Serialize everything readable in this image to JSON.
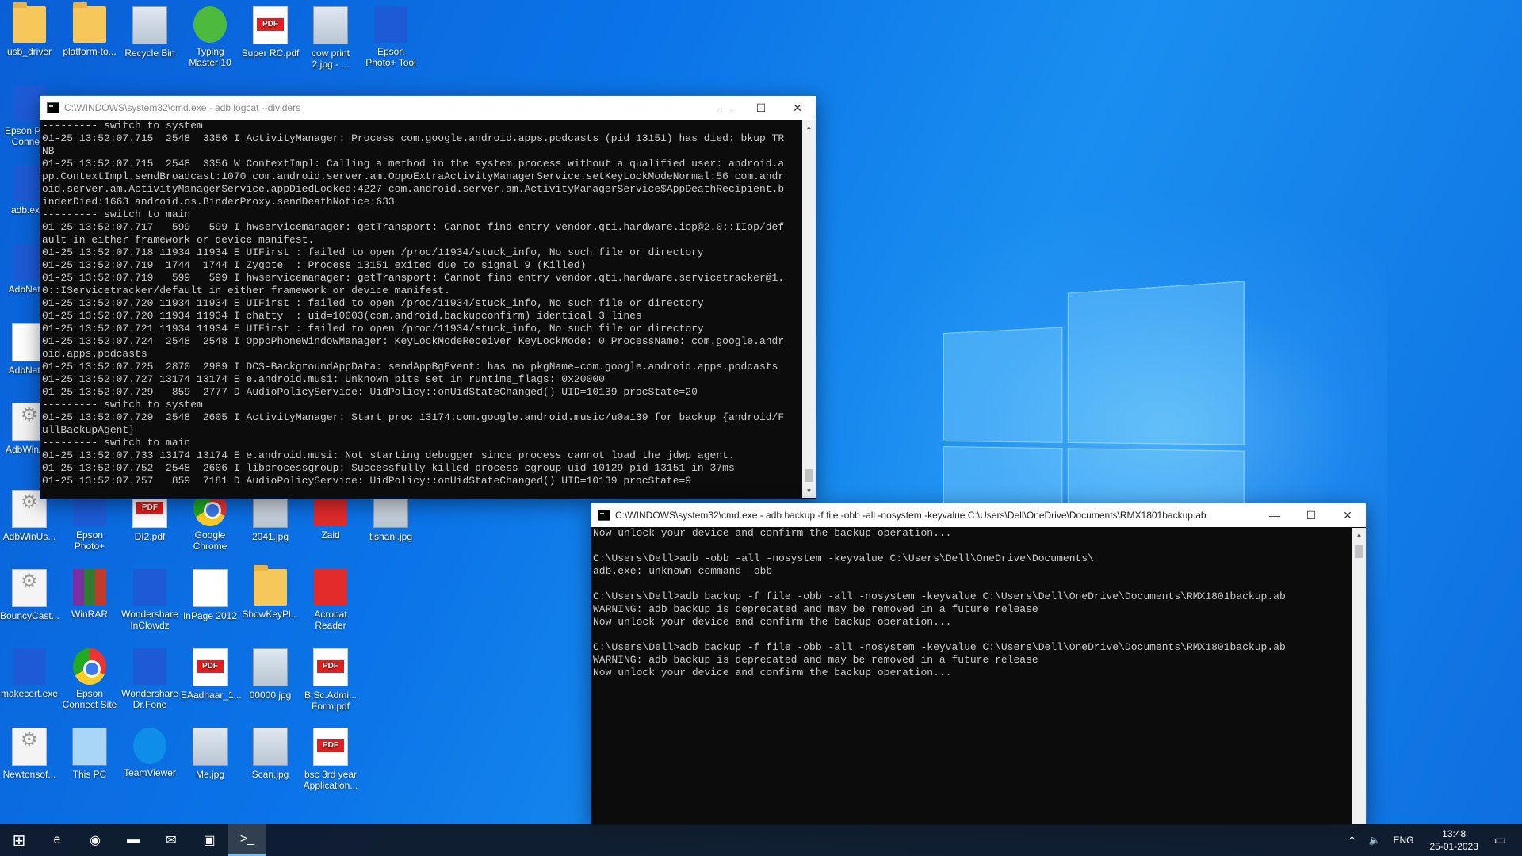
{
  "desktop": {
    "icons": [
      {
        "label": "usb_driver",
        "type": "folder"
      },
      {
        "label": "platform-to...",
        "type": "folder"
      },
      {
        "label": "Recycle Bin",
        "type": "recycle"
      },
      {
        "label": "Typing Master 10",
        "type": "green"
      },
      {
        "label": "Super RC.pdf",
        "type": "pdf"
      },
      {
        "label": "cow print 2.jpg - ...",
        "type": "photo"
      },
      {
        "label": "Epson Photo+ Tool",
        "type": "blue"
      },
      {
        "label": "Epson Pri... Connect",
        "type": "blue"
      },
      {
        "label": "adb.ex...",
        "type": "blue"
      },
      {
        "label": "AdbNati...",
        "type": "blue"
      },
      {
        "label": "AdbNati...",
        "type": "file"
      },
      {
        "label": "AdbWinA...",
        "type": "gear"
      },
      {
        "label": "AdbWinUs...",
        "type": "gear"
      },
      {
        "label": "Epson Photo+",
        "type": "blue"
      },
      {
        "label": "DI2.pdf",
        "type": "pdf"
      },
      {
        "label": "Google Chrome",
        "type": "chrome"
      },
      {
        "label": "2041.jpg",
        "type": "photo"
      },
      {
        "label": "Zaid",
        "type": "red"
      },
      {
        "label": "tishani.jpg",
        "type": "photo"
      },
      {
        "label": "BouncyCast...",
        "type": "gear"
      },
      {
        "label": "WinRAR",
        "type": "rar"
      },
      {
        "label": "Wondershare InClowdz",
        "type": "blue"
      },
      {
        "label": "InPage 2012",
        "type": "file"
      },
      {
        "label": "ShowKeyPl...",
        "type": "folder"
      },
      {
        "label": "Acrobat Reader",
        "type": "red"
      },
      {
        "label": "makecert.exe",
        "type": "blue"
      },
      {
        "label": "Epson Connect Site",
        "type": "chrome"
      },
      {
        "label": "Wondershare Dr.Fone",
        "type": "blue"
      },
      {
        "label": "EAadhaar_1...",
        "type": "pdf"
      },
      {
        "label": "00000.jpg",
        "type": "photo"
      },
      {
        "label": "B.Sc.Admi... Form.pdf",
        "type": "pdf"
      },
      {
        "label": "Newtonsof...",
        "type": "gear"
      },
      {
        "label": "This PC",
        "type": "pc"
      },
      {
        "label": "TeamViewer",
        "type": "tv"
      },
      {
        "label": "Me.jpg",
        "type": "photo"
      },
      {
        "label": "Scan.jpg",
        "type": "photo"
      },
      {
        "label": "bsc 3rd year Application...",
        "type": "pdf"
      }
    ]
  },
  "window1": {
    "title": "C:\\WINDOWS\\system32\\cmd.exe - adb  logcat --dividers",
    "lines": [
      "--------- switch to system",
      "01-25 13:52:07.715  2548  3356 I ActivityManager: Process com.google.android.apps.podcasts (pid 13151) has died: bkup TR",
      "NB",
      "01-25 13:52:07.715  2548  3356 W ContextImpl: Calling a method in the system process without a qualified user: android.a",
      "pp.ContextImpl.sendBroadcast:1070 com.android.server.am.OppoExtraActivityManagerService.setKeyLockModeNormal:56 com.andr",
      "oid.server.am.ActivityManagerService.appDiedLocked:4227 com.android.server.am.ActivityManagerService$AppDeathRecipient.b",
      "inderDied:1663 android.os.BinderProxy.sendDeathNotice:633",
      "--------- switch to main",
      "01-25 13:52:07.717   599   599 I hwservicemanager: getTransport: Cannot find entry vendor.qti.hardware.iop@2.0::IIop/def",
      "ault in either framework or device manifest.",
      "01-25 13:52:07.718 11934 11934 E UIFirst : failed to open /proc/11934/stuck_info, No such file or directory",
      "01-25 13:52:07.719  1744  1744 I Zygote  : Process 13151 exited due to signal 9 (Killed)",
      "01-25 13:52:07.719   599   599 I hwservicemanager: getTransport: Cannot find entry vendor.qti.hardware.servicetracker@1.",
      "0::IServicetracker/default in either framework or device manifest.",
      "01-25 13:52:07.720 11934 11934 E UIFirst : failed to open /proc/11934/stuck_info, No such file or directory",
      "01-25 13:52:07.720 11934 11934 I chatty  : uid=10003(com.android.backupconfirm) identical 3 lines",
      "01-25 13:52:07.721 11934 11934 E UIFirst : failed to open /proc/11934/stuck_info, No such file or directory",
      "01-25 13:52:07.724  2548  2548 I OppoPhoneWindowManager: KeyLockModeReceiver KeyLockMode: 0 ProcessName: com.google.andr",
      "oid.apps.podcasts",
      "01-25 13:52:07.725  2870  2989 I DCS-BackgroundAppData: sendAppBgEvent: has no pkgName=com.google.android.apps.podcasts",
      "01-25 13:52:07.727 13174 13174 E e.android.musi: Unknown bits set in runtime_flags: 0x20000",
      "01-25 13:52:07.729   859  2777 D AudioPolicyService: UidPolicy::onUidStateChanged() UID=10139 procState=20",
      "--------- switch to system",
      "01-25 13:52:07.729  2548  2605 I ActivityManager: Start proc 13174:com.google.android.music/u0a139 for backup {android/F",
      "ullBackupAgent}",
      "--------- switch to main",
      "01-25 13:52:07.733 13174 13174 E e.android.musi: Not starting debugger since process cannot load the jdwp agent.",
      "01-25 13:52:07.752  2548  2606 I libprocessgroup: Successfully killed process cgroup uid 10129 pid 13151 in 37ms",
      "01-25 13:52:07.757   859  7181 D AudioPolicyService: UidPolicy::onUidStateChanged() UID=10139 procState=9"
    ]
  },
  "window2": {
    "title": "C:\\WINDOWS\\system32\\cmd.exe - adb  backup -f file -obb -all -nosystem -keyvalue C:\\Users\\Dell\\OneDrive\\Documents\\RMX1801backup.ab",
    "lines": [
      "Now unlock your device and confirm the backup operation...",
      "",
      "C:\\Users\\Dell>adb -obb -all -nosystem -keyvalue C:\\Users\\Dell\\OneDrive\\Documents\\",
      "adb.exe: unknown command -obb",
      "",
      "C:\\Users\\Dell>adb backup -f file -obb -all -nosystem -keyvalue C:\\Users\\Dell\\OneDrive\\Documents\\RMX1801backup.ab",
      "WARNING: adb backup is deprecated and may be removed in a future release",
      "Now unlock your device and confirm the backup operation...",
      "",
      "C:\\Users\\Dell>adb backup -f file -obb -all -nosystem -keyvalue C:\\Users\\Dell\\OneDrive\\Documents\\RMX1801backup.ab",
      "WARNING: adb backup is deprecated and may be removed in a future release",
      "Now unlock your device and confirm the backup operation..."
    ]
  },
  "controls": {
    "minimize": "—",
    "maximize": "☐",
    "close": "✕"
  },
  "taskbar": {
    "start": "⊞",
    "apps": [
      {
        "name": "edge",
        "glyph": "e"
      },
      {
        "name": "chrome",
        "glyph": "◉"
      },
      {
        "name": "file-explorer",
        "glyph": "▬"
      },
      {
        "name": "mail",
        "glyph": "✉"
      },
      {
        "name": "store",
        "glyph": "▣"
      },
      {
        "name": "cmd",
        "glyph": ">_"
      }
    ],
    "tray": {
      "chevron": "⌃",
      "volume": "🔈",
      "language": "ENG",
      "time": "13:48",
      "date": "25-01-2023",
      "notification": "▭"
    }
  },
  "colors": {
    "terminal_bg": "#0c0c0c",
    "terminal_text": "#cccccc",
    "taskbar": "#10161f",
    "accent": "#2b6bc7"
  }
}
